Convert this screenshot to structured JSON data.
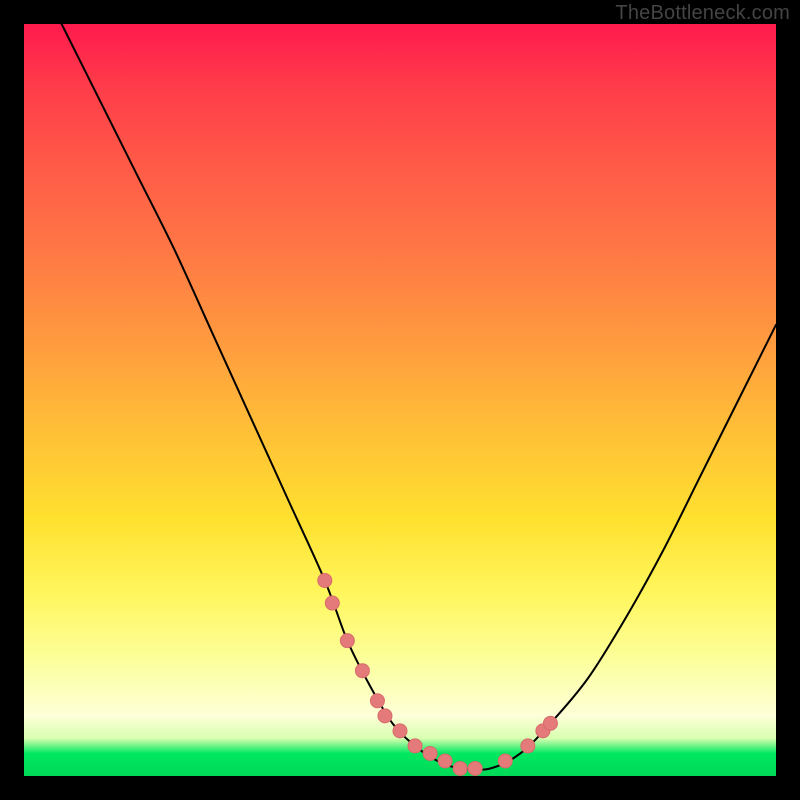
{
  "watermark": "TheBottleneck.com",
  "chart_data": {
    "type": "line",
    "title": "",
    "xlabel": "",
    "ylabel": "",
    "xlim": [
      0,
      100
    ],
    "ylim": [
      0,
      100
    ],
    "grid": false,
    "legend": false,
    "series": [
      {
        "name": "bottleneck-curve",
        "x": [
          5,
          10,
          15,
          20,
          25,
          30,
          35,
          40,
          43,
          46,
          49,
          52,
          55,
          58,
          62,
          66,
          70,
          75,
          80,
          85,
          90,
          95,
          100
        ],
        "y": [
          100,
          90,
          80,
          70,
          59,
          48,
          37,
          26,
          18,
          12,
          7,
          4,
          2,
          1,
          1,
          3,
          7,
          13,
          21,
          30,
          40,
          50,
          60
        ]
      }
    ],
    "markers": {
      "name": "highlight-dots",
      "x": [
        40,
        41,
        43,
        45,
        47,
        48,
        50,
        52,
        54,
        56,
        58,
        60,
        64,
        67,
        69,
        70
      ],
      "y": [
        26,
        23,
        18,
        14,
        10,
        8,
        6,
        4,
        3,
        2,
        1,
        1,
        2,
        4,
        6,
        7
      ]
    },
    "background_gradient": {
      "top": "#ff1a4d",
      "mid": "#ffe12f",
      "bottom": "#00d858"
    }
  }
}
